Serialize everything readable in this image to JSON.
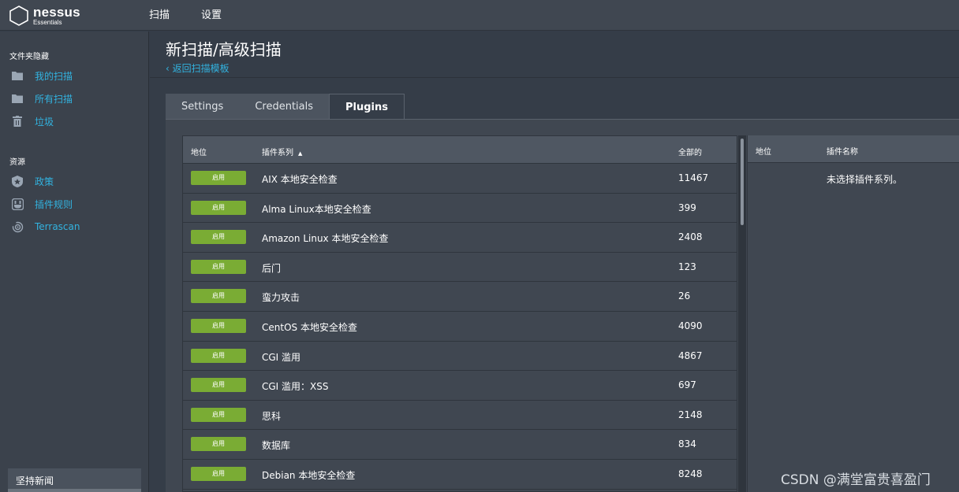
{
  "topbar": {
    "logo_name": "nessus",
    "logo_sub": "Essentials",
    "nav": [
      "扫描",
      "设置"
    ]
  },
  "sidebar": {
    "section1": "文件夹隐藏",
    "folders": [
      {
        "label": "我的扫描",
        "icon": "folder-icon"
      },
      {
        "label": "所有扫描",
        "icon": "folder-icon"
      },
      {
        "label": "垃圾",
        "icon": "trash-icon"
      }
    ],
    "section2": "资源",
    "resources": [
      {
        "label": "政策",
        "icon": "policy-icon"
      },
      {
        "label": "插件规则",
        "icon": "plugin-rules-icon"
      },
      {
        "label": "Terrascan",
        "icon": "terrascan-icon"
      }
    ],
    "news": "坚持新闻"
  },
  "main": {
    "title": "新扫描/高级扫描",
    "back_link": "‹ 返回扫描模板",
    "tabs": [
      "Settings",
      "Credentials",
      "Plugins"
    ],
    "active_tab": "Plugins"
  },
  "plugin_families": {
    "headers": {
      "status": "地位",
      "family": "插件系列",
      "total": "全部的"
    },
    "sort_indicator": "▲",
    "rows": [
      {
        "status": "启用",
        "family": "AIX 本地安全检查",
        "total": "11467"
      },
      {
        "status": "启用",
        "family": "Alma Linux本地安全检查",
        "total": "399"
      },
      {
        "status": "启用",
        "family": "Amazon Linux 本地安全检查",
        "total": "2408"
      },
      {
        "status": "启用",
        "family": "后门",
        "total": "123"
      },
      {
        "status": "启用",
        "family": "蛮力攻击",
        "total": "26"
      },
      {
        "status": "启用",
        "family": "CentOS 本地安全检查",
        "total": "4090"
      },
      {
        "status": "启用",
        "family": "CGI 滥用",
        "total": "4867"
      },
      {
        "status": "启用",
        "family": "CGI 滥用：XSS",
        "total": "697"
      },
      {
        "status": "启用",
        "family": "思科",
        "total": "2148"
      },
      {
        "status": "启用",
        "family": "数据库",
        "total": "834"
      },
      {
        "status": "启用",
        "family": "Debian 本地安全检查",
        "total": "8248"
      }
    ]
  },
  "plugins_panel": {
    "headers": {
      "status": "地位",
      "name": "插件名称"
    },
    "empty_message": "未选择插件系列。"
  },
  "watermark": "CSDN @满堂富贵喜盈门",
  "colors": {
    "accent": "#32b3e0",
    "enabled": "#7aac34",
    "topbar": "#404751",
    "sidebar": "#3b424c"
  }
}
